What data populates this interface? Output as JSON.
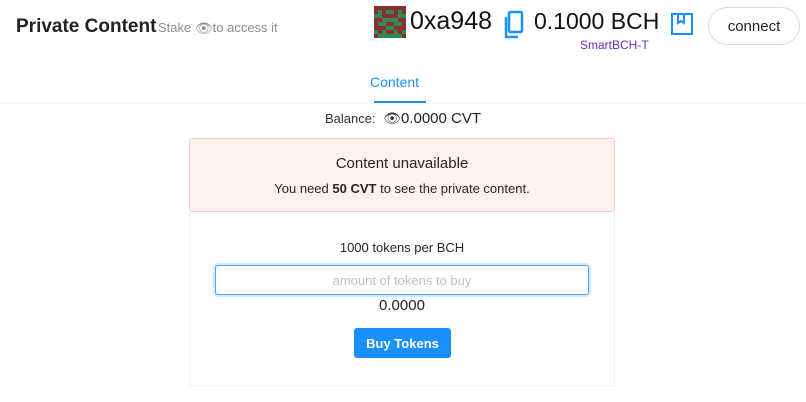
{
  "header": {
    "app_title": "Private Content",
    "tagline_before": "Stake ",
    "tagline_icon": "eye-icon",
    "tagline_after": "to access it",
    "wallet": {
      "address": "0xa948",
      "balance": "0.1000 BCH",
      "network": "SmartBCH-T",
      "network_color": "#6a2cc2",
      "avatar_icon": "identicon-avatar",
      "copy_icon": "copy-icon",
      "wallet_icon": "wallet-book-icon"
    },
    "connect_label": "connect"
  },
  "tabs": {
    "items": [
      {
        "label": "Content",
        "active": true
      }
    ],
    "accent_color": "#1890ff"
  },
  "balance": {
    "label": "Balance:",
    "icon": "eye-icon",
    "value": "0.0000 CVT"
  },
  "alert": {
    "title": "Content unavailable",
    "desc_before": "You need ",
    "desc_bold": "50 CVT",
    "desc_after": " to see the private content.",
    "bg_color": "#fff1f0",
    "border_color": "#ffccc7"
  },
  "purchase": {
    "rate": "1000 tokens per BCH",
    "input_value": "",
    "input_placeholder": "amount of tokens to buy",
    "cost": "0.0000",
    "buy_label": "Buy Tokens",
    "button_color": "#1890ff"
  }
}
